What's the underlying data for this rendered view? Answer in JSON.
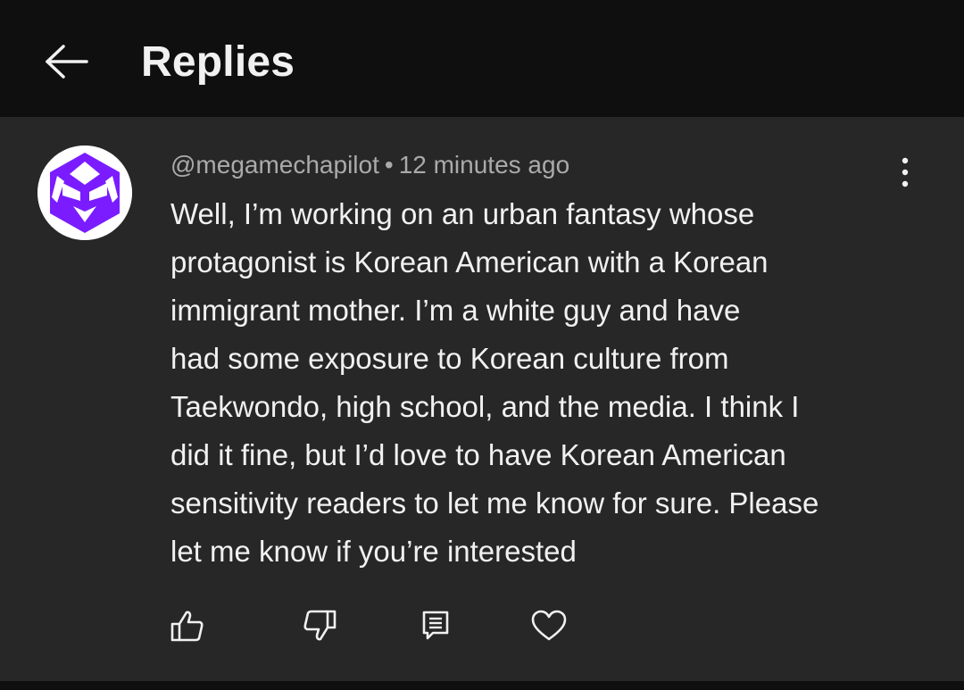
{
  "header": {
    "title": "Replies",
    "back_icon": "arrow-left-icon"
  },
  "comment": {
    "author": "@megamechapilot",
    "separator": "•",
    "timestamp": "12 minutes ago",
    "avatar_color": "#7a1cff",
    "text": "Well, I’m working on an urban fantasy whose\nprotagonist is Korean American with a Korean\nimmigrant mother. I’m a white guy and have\nhad some exposure to Korean culture from\nTaekwondo, high school, and the media. I think I\ndid it fine, but I’d love to have Korean American\nsensitivity readers to let me know for sure. Please\nlet me know if you’re interested",
    "actions": {
      "like_icon": "thumbs-up-icon",
      "dislike_icon": "thumbs-down-icon",
      "reply_icon": "reply-icon",
      "heart_icon": "heart-icon"
    },
    "more_icon": "more-vertical-icon"
  },
  "colors": {
    "background": "#0f0f0f",
    "panel": "#272727",
    "text_primary": "#f1f1f1",
    "text_secondary": "#aaaaaa"
  }
}
